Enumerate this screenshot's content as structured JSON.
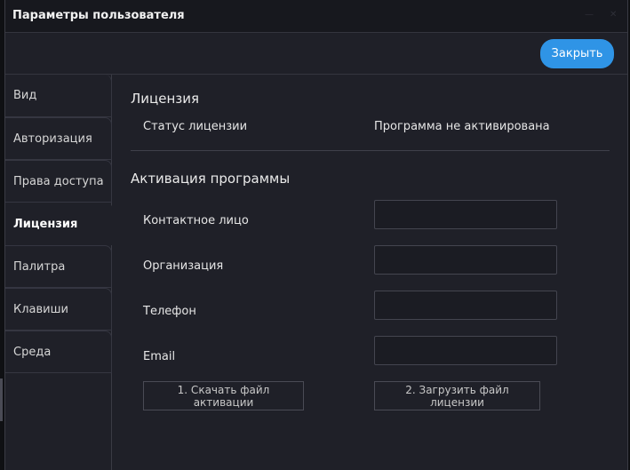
{
  "window": {
    "title": "Параметры пользователя",
    "close_label": "Закрыть"
  },
  "sidebar": {
    "items": [
      {
        "label": "Вид"
      },
      {
        "label": "Авторизация"
      },
      {
        "label": "Права доступа"
      },
      {
        "label": "Лицензия"
      },
      {
        "label": "Палитра"
      },
      {
        "label": "Клавиши"
      },
      {
        "label": "Среда"
      }
    ],
    "active": "Лицензия"
  },
  "license": {
    "section_title": "Лицензия",
    "status_label": "Статус лицензии",
    "status_value": "Программа не активирована"
  },
  "activation": {
    "section_title": "Активация программы",
    "fields": [
      {
        "label": "Контактное лицо",
        "value": ""
      },
      {
        "label": "Организация",
        "value": ""
      },
      {
        "label": "Телефон",
        "value": ""
      },
      {
        "label": "Email",
        "value": ""
      }
    ],
    "download_button": "1. Скачать файл активации",
    "upload_button": "2. Загрузить файл лицензии"
  }
}
